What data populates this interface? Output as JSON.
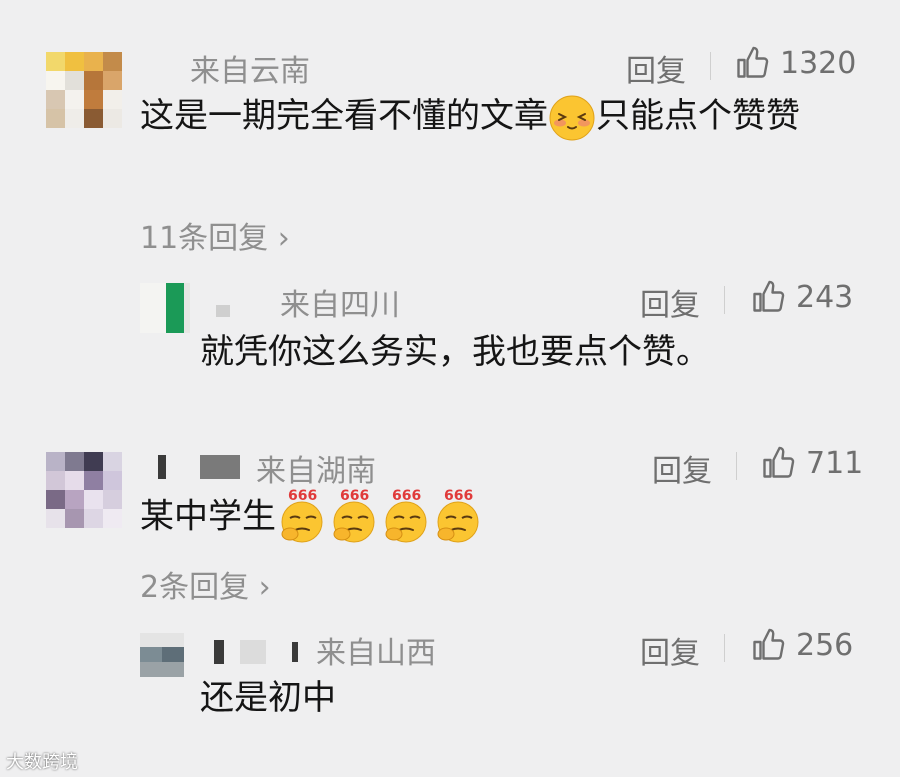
{
  "comments": [
    {
      "location": "来自云南",
      "reply_label": "回复",
      "likes": "1320",
      "text_before_emoji": "这是一期完全看不懂的文章",
      "text_after_emoji": "只能点个赞赞",
      "more_replies": "11条回复",
      "emoji": "blushing-face-icon"
    },
    {
      "location": "来自四川",
      "reply_label": "回复",
      "likes": "243",
      "text": "就凭你这么务实，我也要点个赞。"
    },
    {
      "location": "来自湖南",
      "reply_label": "回复",
      "likes": "711",
      "text": "某中学生",
      "emoji_label": "666",
      "emoji_count": 4,
      "more_replies": "2条回复"
    },
    {
      "location": "来自山西",
      "reply_label": "回复",
      "likes": "256",
      "text": "还是初中"
    }
  ],
  "watermark": "大数跨境",
  "colors": {
    "background": "#efeff0",
    "meta": "#8f8f8f",
    "text": "#151515"
  }
}
